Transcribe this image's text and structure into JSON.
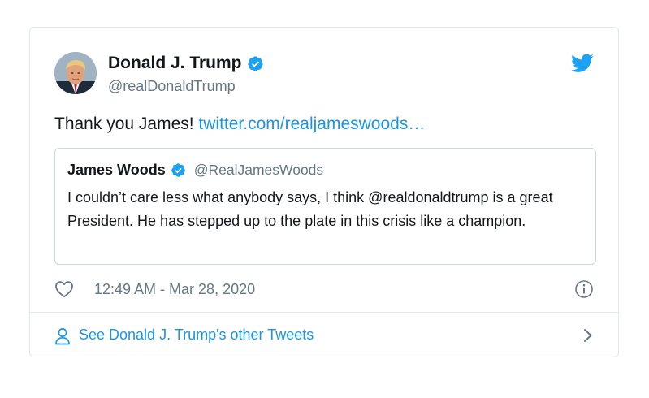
{
  "tweet": {
    "author_name": "Donald J. Trump",
    "author_handle": "@realDonaldTrump",
    "text": "Thank you James! ",
    "link_text": "twitter.com/realjameswoods…",
    "timestamp": "12:49 AM - Mar 28, 2020"
  },
  "quoted_tweet": {
    "author_name": "James Woods",
    "author_handle": "@RealJamesWoods",
    "text": "I couldn’t care less what anybody says, I think @realdonaldtrump is a great President. He has stepped up to the plate in this crisis like a champion."
  },
  "footer": {
    "label": "See Donald J. Trump's other Tweets"
  },
  "icons": {
    "verified": "verified-badge-icon",
    "brand": "twitter-bird-icon",
    "like": "heart-icon",
    "info": "info-icon",
    "profile": "person-icon",
    "chevron": "chevron-right-icon"
  },
  "colors": {
    "accent": "#1b95e0",
    "verified": "#1da1f2",
    "text_primary": "#14171a",
    "text_secondary": "#657786",
    "border": "#e1e8ed"
  }
}
